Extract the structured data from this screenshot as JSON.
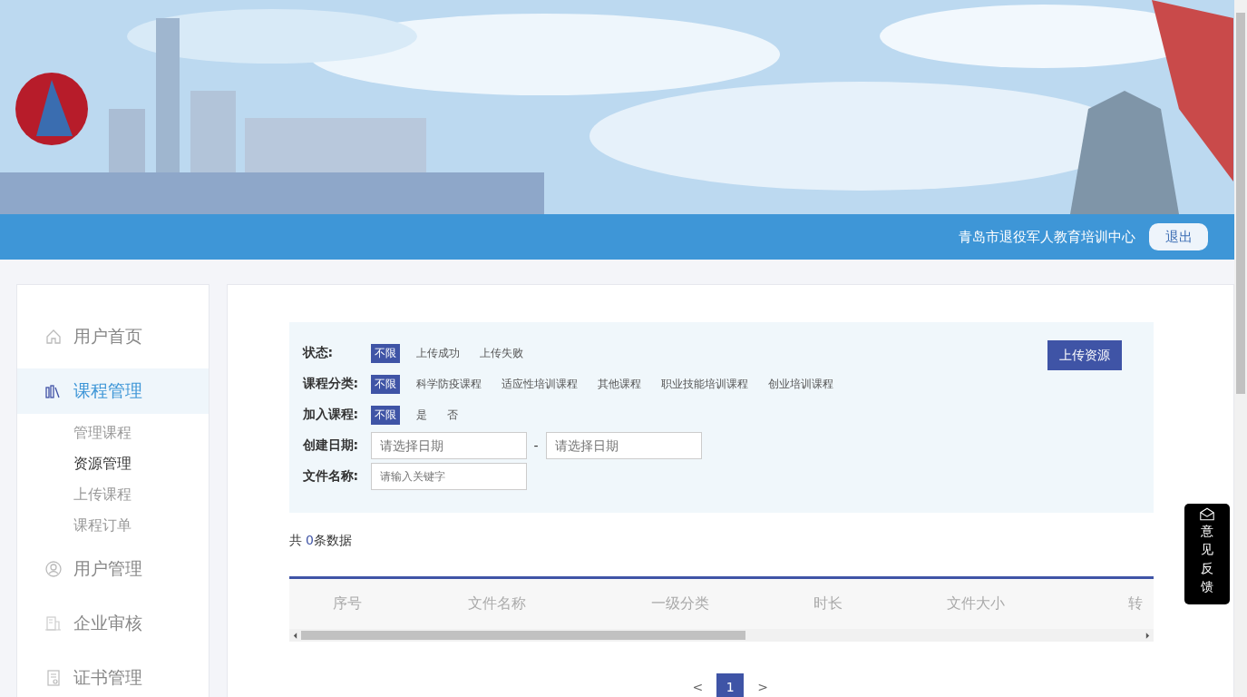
{
  "topbar": {
    "organization": "青岛市退役军人教育培训中心",
    "logout": "退出"
  },
  "sidebar": {
    "items": [
      {
        "label": "用户首页",
        "selected": false
      },
      {
        "label": "课程管理",
        "selected": true,
        "children": [
          {
            "label": "管理课程",
            "selected": false
          },
          {
            "label": "资源管理",
            "selected": true
          },
          {
            "label": "上传课程",
            "selected": false
          },
          {
            "label": "课程订单",
            "selected": false
          }
        ]
      },
      {
        "label": "用户管理",
        "selected": false
      },
      {
        "label": "企业审核",
        "selected": false
      },
      {
        "label": "证书管理",
        "selected": false
      }
    ]
  },
  "filters": [
    {
      "label": "状态:",
      "options": [
        {
          "label": "不限",
          "selected": true
        },
        {
          "label": "上传成功",
          "selected": false
        },
        {
          "label": "上传失败",
          "selected": false
        }
      ]
    },
    {
      "label": "课程分类:",
      "options": [
        {
          "label": "不限",
          "selected": true
        },
        {
          "label": "科学防疫课程",
          "selected": false
        },
        {
          "label": "适应性培训课程",
          "selected": false
        },
        {
          "label": "其他课程",
          "selected": false
        },
        {
          "label": "职业技能培训课程",
          "selected": false
        },
        {
          "label": "创业培训课程",
          "selected": false
        }
      ]
    },
    {
      "label": "加入课程:",
      "options": [
        {
          "label": "不限",
          "selected": true
        },
        {
          "label": "是",
          "selected": false
        },
        {
          "label": "否",
          "selected": false
        }
      ]
    }
  ],
  "upload_button": "上传资源",
  "date_filter": {
    "label": "创建日期:",
    "from_placeholder": "请选择日期",
    "separator": "-",
    "to_placeholder": "请选择日期"
  },
  "name_filter": {
    "label": "文件名称:",
    "placeholder": "请输入关键字"
  },
  "summary": {
    "prefix": "共 ",
    "count": "0",
    "suffix": "条数据"
  },
  "table": {
    "columns": [
      "序号",
      "文件名称",
      "一级分类",
      "时长",
      "文件大小",
      "转"
    ]
  },
  "pagination": {
    "prev": "<",
    "pages": [
      {
        "label": "1",
        "selected": true
      }
    ],
    "next": ">"
  },
  "feedback": {
    "label": "意见反馈"
  }
}
